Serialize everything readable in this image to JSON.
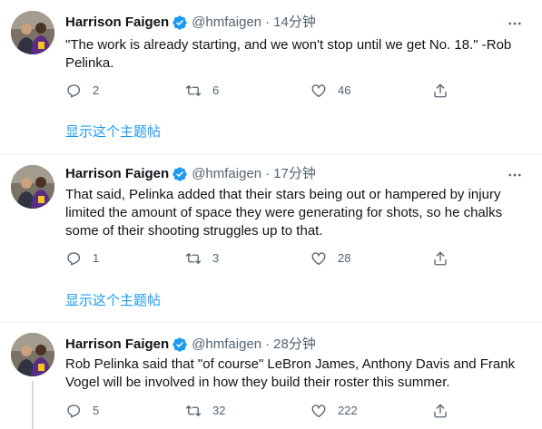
{
  "tweets": [
    {
      "name": "Harrison Faigen",
      "handle": "@hmfaigen",
      "dot": "·",
      "time": "14分钟",
      "text": "\"The work is already starting, and we won't stop until we get No. 18.\" -Rob Pelinka.",
      "replies": "2",
      "retweets": "6",
      "likes": "46",
      "show_thread": "显示这个主题帖"
    },
    {
      "name": "Harrison Faigen",
      "handle": "@hmfaigen",
      "dot": "·",
      "time": "17分钟",
      "text": "That said, Pelinka added that their stars being out or hampered by injury limited the amount of space they were generating for shots, so he chalks some of their shooting struggles up to that.",
      "replies": "1",
      "retweets": "3",
      "likes": "28",
      "show_thread": "显示这个主题帖"
    },
    {
      "name": "Harrison Faigen",
      "handle": "@hmfaigen",
      "dot": "·",
      "time": "28分钟",
      "text": "Rob Pelinka said that \"of course\" LeBron James, Anthony Davis and Frank Vogel will be involved in how they build their roster this summer.",
      "replies": "5",
      "retweets": "32",
      "likes": "222"
    }
  ],
  "icons": {
    "verified": "verified-badge-icon",
    "more": "more-icon",
    "reply": "reply-icon",
    "retweet": "retweet-icon",
    "like": "heart-icon",
    "share": "share-icon"
  },
  "colors": {
    "accent": "#1d9bf0",
    "text": "#0f1419",
    "secondary": "#536471",
    "border": "#ebeef0"
  }
}
